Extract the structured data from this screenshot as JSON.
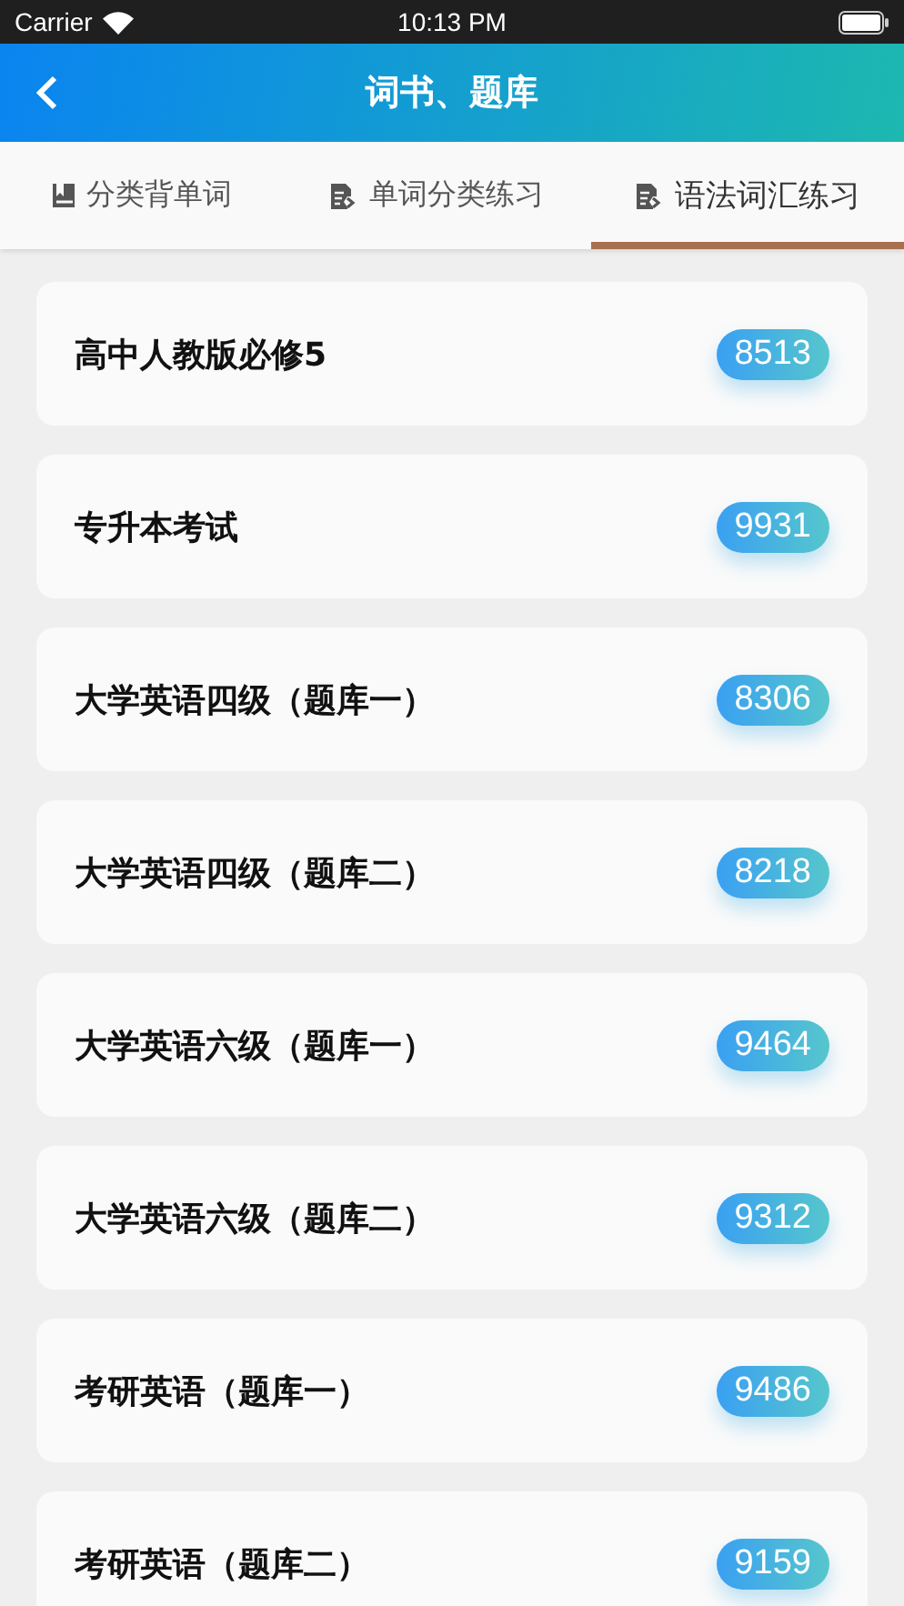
{
  "status_bar": {
    "carrier": "Carrier",
    "time": "10:13 PM"
  },
  "nav": {
    "title": "词书、题库"
  },
  "tabs": [
    {
      "label": "分类背单词",
      "kind": "book",
      "selected": false
    },
    {
      "label": "单词分类练习",
      "kind": "exercise",
      "selected": false
    },
    {
      "label": "语法词汇练习",
      "kind": "exercise",
      "selected": true
    }
  ],
  "items": [
    {
      "title": "高中人教版必修5",
      "count": "8513"
    },
    {
      "title": "专升本考试",
      "count": "9931"
    },
    {
      "title": "大学英语四级（题库一）",
      "count": "8306"
    },
    {
      "title": "大学英语四级（题库二）",
      "count": "8218"
    },
    {
      "title": "大学英语六级（题库一）",
      "count": "9464"
    },
    {
      "title": "大学英语六级（题库二）",
      "count": "9312"
    },
    {
      "title": "考研英语（题库一）",
      "count": "9486"
    },
    {
      "title": "考研英语（题库二）",
      "count": "9159"
    }
  ]
}
